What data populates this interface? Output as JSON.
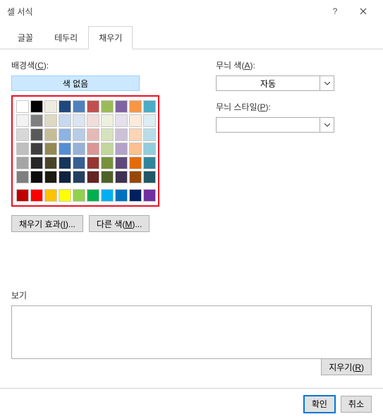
{
  "title": "셀 서식",
  "tabs": {
    "font": "글꼴",
    "border": "테두리",
    "fill": "채우기"
  },
  "labels": {
    "bgcolor": "배경색(C):",
    "nocolor": "색 없음",
    "patterncolor": "무늬 색(A):",
    "patternstyle": "무늬 스타일(P):",
    "auto": "자동",
    "filleffects": "채우기 효과(I)...",
    "morecolors": "다른 색(M)...",
    "preview": "보기",
    "clear": "지우기(R)",
    "ok": "확인",
    "cancel": "취소"
  },
  "palette": {
    "theme": [
      [
        "#ffffff",
        "#000000",
        "#eeece1",
        "#1f497d",
        "#4f81bd",
        "#c0504d",
        "#9bbb59",
        "#8064a2",
        "#f79646",
        "#4bacc6"
      ],
      [
        "#f2f2f2",
        "#7f7f7f",
        "#ddd9c3",
        "#c6d9f0",
        "#dbe5f1",
        "#f2dcdb",
        "#ebf1dd",
        "#e5e0ec",
        "#fdeada",
        "#dbeef3"
      ],
      [
        "#d8d8d8",
        "#595959",
        "#c4bd97",
        "#8db3e2",
        "#b8cce4",
        "#e5b9b7",
        "#d7e3bc",
        "#ccc1d9",
        "#fbd5b5",
        "#b7dde8"
      ],
      [
        "#bfbfbf",
        "#3f3f3f",
        "#938953",
        "#548dd4",
        "#95b3d7",
        "#d99694",
        "#c3d69b",
        "#b2a2c7",
        "#fac08f",
        "#92cddc"
      ],
      [
        "#a5a5a5",
        "#262626",
        "#494429",
        "#17365d",
        "#366092",
        "#953734",
        "#76923c",
        "#5f497a",
        "#e36c09",
        "#31859b"
      ],
      [
        "#7f7f7f",
        "#0c0c0c",
        "#1d1b10",
        "#0f243e",
        "#244061",
        "#632423",
        "#4f6128",
        "#3f3151",
        "#974806",
        "#205867"
      ]
    ],
    "standard": [
      "#c00000",
      "#ff0000",
      "#ffc000",
      "#ffff00",
      "#92d050",
      "#00b050",
      "#00b0f0",
      "#0070c0",
      "#002060",
      "#7030a0"
    ]
  }
}
